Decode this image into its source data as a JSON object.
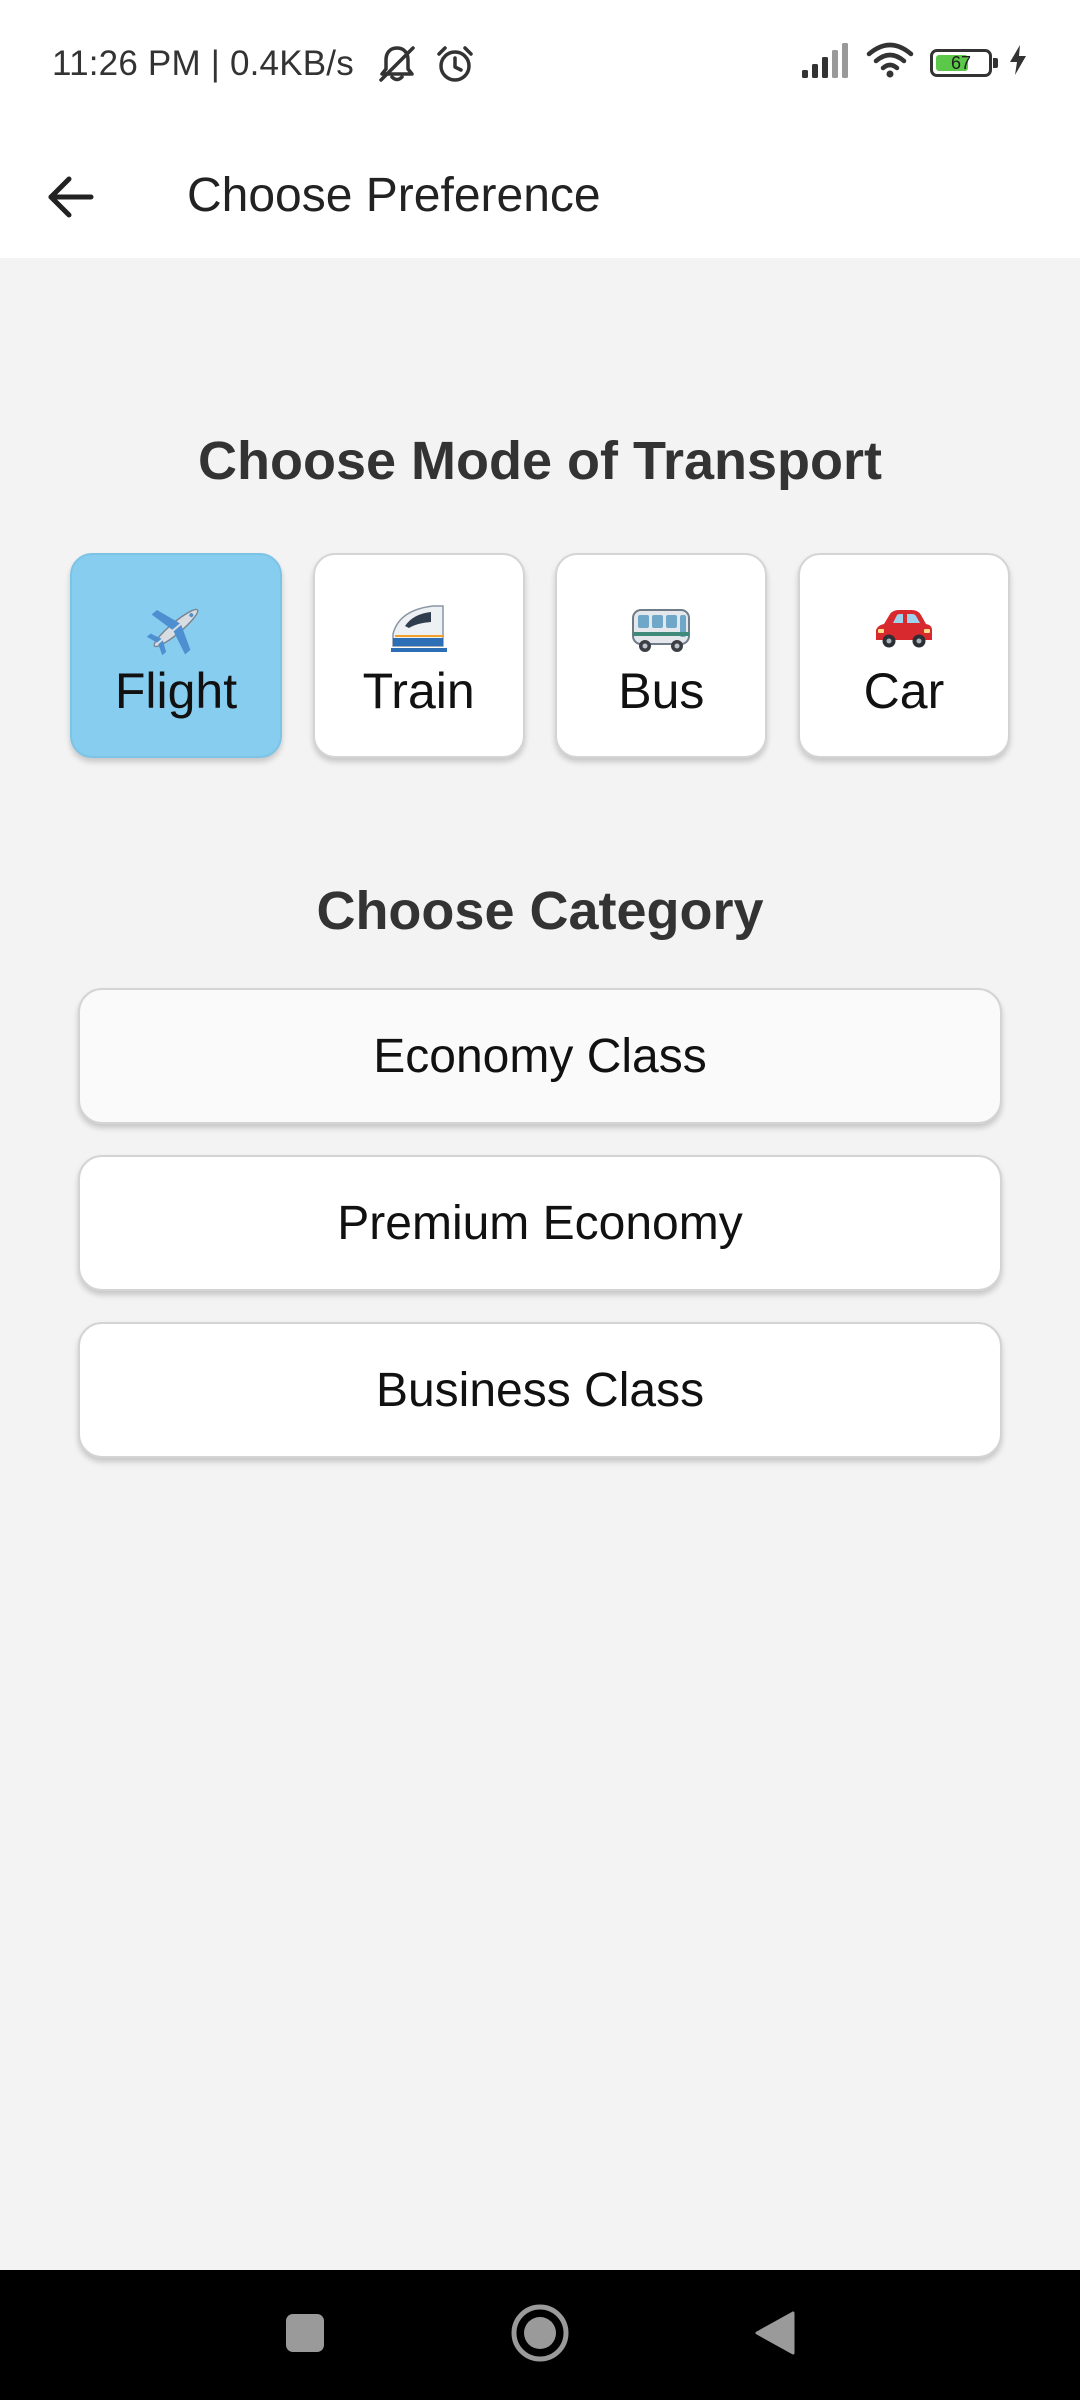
{
  "status_bar": {
    "time_and_speed": "11:26 PM | 0.4KB/s",
    "battery_level": "67",
    "battery_fraction": 0.67
  },
  "app_bar": {
    "title": "Choose Preference"
  },
  "transport": {
    "title": "Choose Mode of Transport",
    "selected": "Flight",
    "options": [
      {
        "label": "Flight",
        "icon": "airplane-icon",
        "selected": true
      },
      {
        "label": "Train",
        "icon": "bullet-train-icon",
        "selected": false
      },
      {
        "label": "Bus",
        "icon": "bus-icon",
        "selected": false
      },
      {
        "label": "Car",
        "icon": "car-icon",
        "selected": false
      }
    ]
  },
  "category": {
    "title": "Choose Category",
    "options": [
      {
        "label": "Economy Class"
      },
      {
        "label": "Premium Economy"
      },
      {
        "label": "Business Class"
      }
    ]
  },
  "colors": {
    "selected_card": "#87cdef",
    "background": "#f3f3f3",
    "card": "#ffffff"
  }
}
